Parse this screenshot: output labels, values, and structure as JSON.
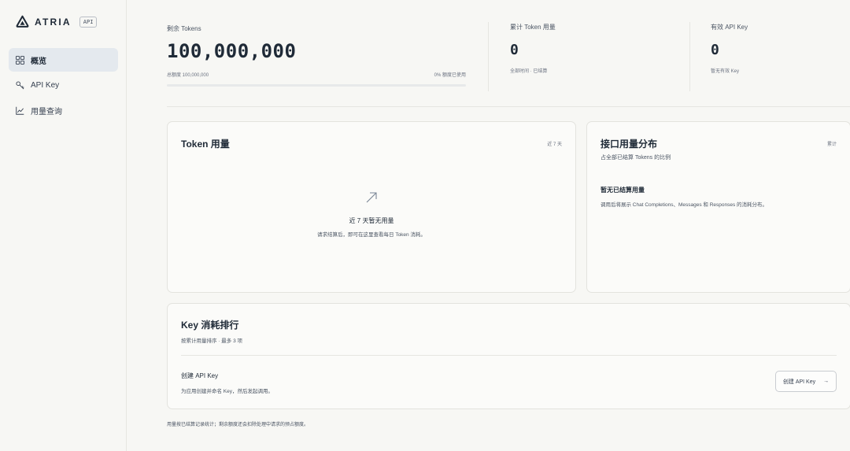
{
  "brand": {
    "name": "ATRIA",
    "badge": "API"
  },
  "nav": [
    {
      "label": "概览",
      "icon": "grid-icon",
      "active": true
    },
    {
      "label": "API Key",
      "icon": "key-icon",
      "active": false
    },
    {
      "label": "用量查询",
      "icon": "chart-line-icon",
      "active": false
    }
  ],
  "stats": {
    "remaining": {
      "label": "剩余 Tokens",
      "value": "100,000,000",
      "total_label": "总额度 100,000,000",
      "used_label": "0% 额度已使用",
      "used_fraction": 0
    },
    "cumulative": {
      "label": "累计 Token 用量",
      "value": "0",
      "sub": "全部时间 · 已结算"
    },
    "keys": {
      "label": "有效 API Key",
      "value": "0",
      "sub": "暂无有效 Key"
    }
  },
  "token_card": {
    "title": "Token 用量",
    "range": "近 7 天",
    "empty_title": "近 7 天暂无用量",
    "empty_desc": "请求结算后，即可在这里查看每日 Token 消耗。"
  },
  "api_card": {
    "title": "接口用量分布",
    "range": "累计",
    "subtitle": "占全部已结算 Tokens 的比例",
    "empty_title": "暂无已结算用量",
    "empty_desc": "调用后将展示 Chat Completions、Messages 和 Responses 的消耗分布。"
  },
  "rank_card": {
    "title": "Key 消耗排行",
    "subtitle": "按累计用量排序 · 最多 3 项",
    "create_title": "创建 API Key",
    "create_desc": "为应用创建并命名 Key，然后发起调用。",
    "create_button": "创建 API Key",
    "arrow": "→"
  },
  "footer": "用量按已结算记录统计；剩余额度还会扣除处理中请求的预占额度。",
  "colors": {
    "accent": "#1f2a37",
    "active_bg": "#e4e9ee",
    "icon": "#7a8696"
  }
}
